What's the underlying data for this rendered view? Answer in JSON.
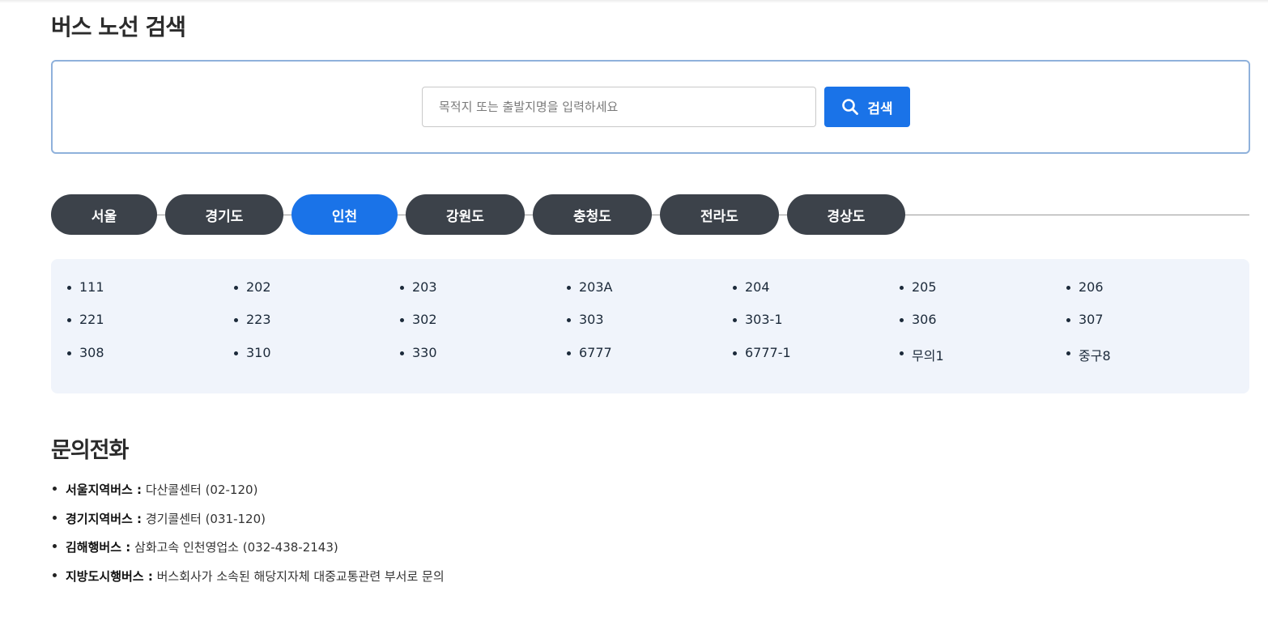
{
  "page_title": "버스 노선 검색",
  "search": {
    "placeholder": "목적지 또는 출발지명을 입력하세요",
    "value": "",
    "button_label": "검색",
    "button_icon": "search-icon"
  },
  "colors": {
    "accent": "#1a73e8",
    "tab_inactive": "#3c424a",
    "panel_bg": "#f0f4fb",
    "search_border": "#8fb1db"
  },
  "regions": [
    {
      "label": "서울",
      "active": false
    },
    {
      "label": "경기도",
      "active": false
    },
    {
      "label": "인천",
      "active": true
    },
    {
      "label": "강원도",
      "active": false
    },
    {
      "label": "충청도",
      "active": false
    },
    {
      "label": "전라도",
      "active": false
    },
    {
      "label": "경상도",
      "active": false
    }
  ],
  "routes": [
    "111",
    "202",
    "203",
    "203A",
    "204",
    "205",
    "206",
    "221",
    "223",
    "302",
    "303",
    "303-1",
    "306",
    "307",
    "308",
    "310",
    "330",
    "6777",
    "6777-1",
    "무의1",
    "중구8"
  ],
  "contact": {
    "title": "문의전화",
    "items": [
      {
        "label": "서울지역버스 :",
        "value": "다산콜센터 (02-120)"
      },
      {
        "label": "경기지역버스 :",
        "value": "경기콜센터 (031-120)"
      },
      {
        "label": "김해행버스 :",
        "value": "삼화고속 인천영업소 (032-438-2143)"
      },
      {
        "label": "지방도시행버스 :",
        "value": "버스회사가 소속된 해당지자체 대중교통관련 부서로 문의"
      }
    ]
  }
}
